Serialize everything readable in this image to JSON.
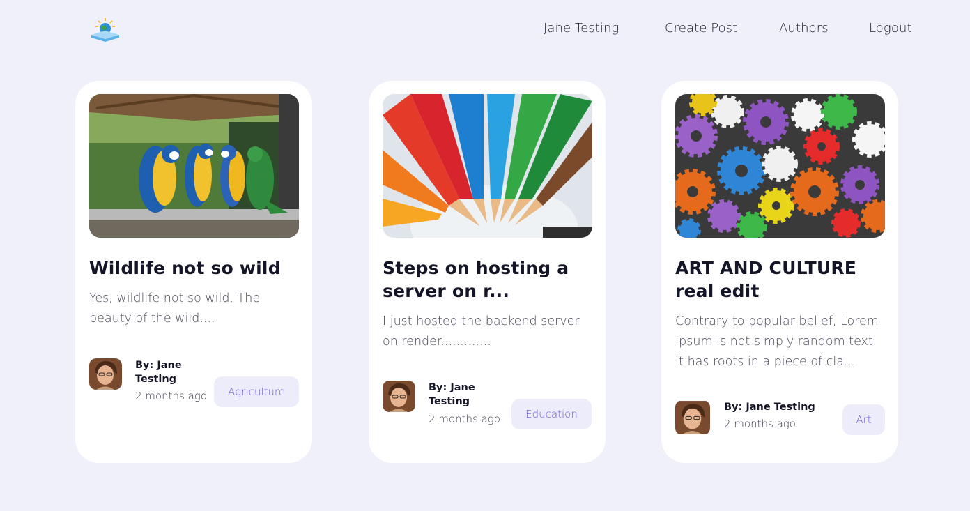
{
  "nav": {
    "links": [
      "Jane Testing",
      "Create Post",
      "Authors",
      "Logout"
    ]
  },
  "posts": [
    {
      "title": "Wildlife not so wild",
      "excerpt": "Yes, wildlife not so wild. The beauty of the wild....",
      "author": "By: Jane Testing",
      "time": "2 months ago",
      "category": "Agriculture",
      "image": "parrots-photo"
    },
    {
      "title": "Steps on hosting a server on r...",
      "excerpt": "I just hosted the backend server on render.............",
      "author": "By: Jane Testing",
      "time": "2 months ago",
      "category": "Education",
      "image": "colored-pencils-photo"
    },
    {
      "title": "ART AND CULTURE real edit",
      "excerpt": "Contrary to popular belief, Lorem Ipsum is not simply random text. It has roots in a piece of cla...",
      "author": "By: Jane Testing",
      "time": "2 months ago",
      "category": "Art",
      "image": "colorful-gears-photo"
    }
  ],
  "colors": {
    "background": "#f0f0fb",
    "card": "#ffffff",
    "category_bg": "#ececfb",
    "category_text": "#6b5fd8"
  }
}
